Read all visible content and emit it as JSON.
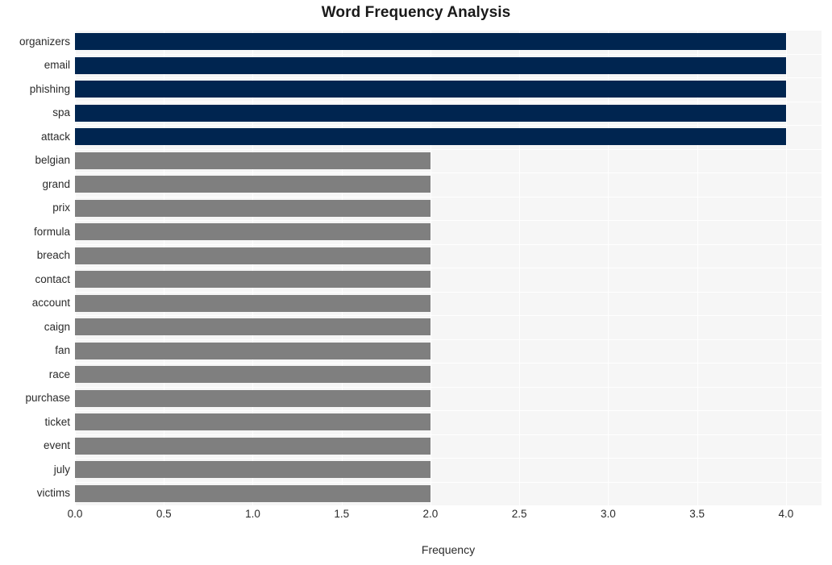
{
  "chart_data": {
    "type": "bar",
    "orientation": "horizontal",
    "title": "Word Frequency Analysis",
    "xlabel": "Frequency",
    "ylabel": "",
    "xlim": [
      0.0,
      4.2
    ],
    "xticks": [
      "0.0",
      "0.5",
      "1.0",
      "1.5",
      "2.0",
      "2.5",
      "3.0",
      "3.5",
      "4.0"
    ],
    "xtick_values": [
      0.0,
      0.5,
      1.0,
      1.5,
      2.0,
      2.5,
      3.0,
      3.5,
      4.0
    ],
    "grid": true,
    "legend": "none",
    "categories": [
      "organizers",
      "email",
      "phishing",
      "spa",
      "attack",
      "belgian",
      "grand",
      "prix",
      "formula",
      "breach",
      "contact",
      "account",
      "caign",
      "fan",
      "race",
      "purchase",
      "ticket",
      "event",
      "july",
      "victims"
    ],
    "values": [
      4,
      4,
      4,
      4,
      4,
      2,
      2,
      2,
      2,
      2,
      2,
      2,
      2,
      2,
      2,
      2,
      2,
      2,
      2,
      2
    ],
    "bar_colors": [
      "#002550",
      "#002550",
      "#002550",
      "#002550",
      "#002550",
      "#7f7f7f",
      "#7f7f7f",
      "#7f7f7f",
      "#7f7f7f",
      "#7f7f7f",
      "#7f7f7f",
      "#7f7f7f",
      "#7f7f7f",
      "#7f7f7f",
      "#7f7f7f",
      "#7f7f7f",
      "#7f7f7f",
      "#7f7f7f",
      "#7f7f7f",
      "#7f7f7f"
    ],
    "highlight_color": "#002550",
    "default_color": "#7f7f7f",
    "plot_background": "#f6f6f6",
    "gridline_color": "#ffffff",
    "figure_background": "#ffffff"
  }
}
